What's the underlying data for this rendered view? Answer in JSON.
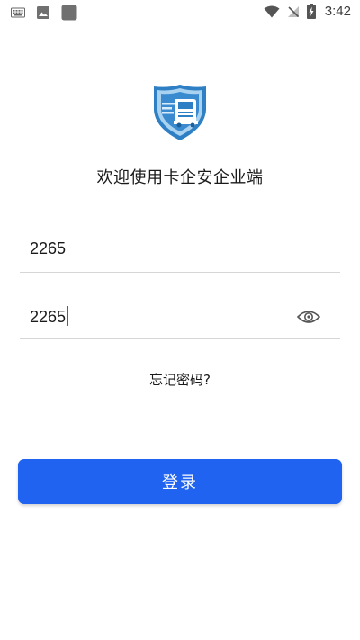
{
  "status_bar": {
    "time": "3:42",
    "left_icons": [
      "keyboard-icon",
      "image-icon",
      "app-square-icon"
    ],
    "right_icons": [
      "wifi-icon",
      "no-signal-icon",
      "battery-charging-icon"
    ]
  },
  "logo": {
    "name": "truck-shield-logo",
    "colors": {
      "shield": "#2e7fc4",
      "accent": "#7bb8e8",
      "truck": "#ffffff"
    }
  },
  "welcome": {
    "text": "欢迎使用卡企安企业端"
  },
  "form": {
    "username": {
      "value": "2265"
    },
    "password": {
      "value": "2265",
      "toggle_icon": "eye-icon"
    },
    "forgot_label": "忘记密码?",
    "login_label": "登录"
  },
  "colors": {
    "primary": "#1f63f0",
    "caret": "#e0196b",
    "divider": "#d6d6d6"
  }
}
